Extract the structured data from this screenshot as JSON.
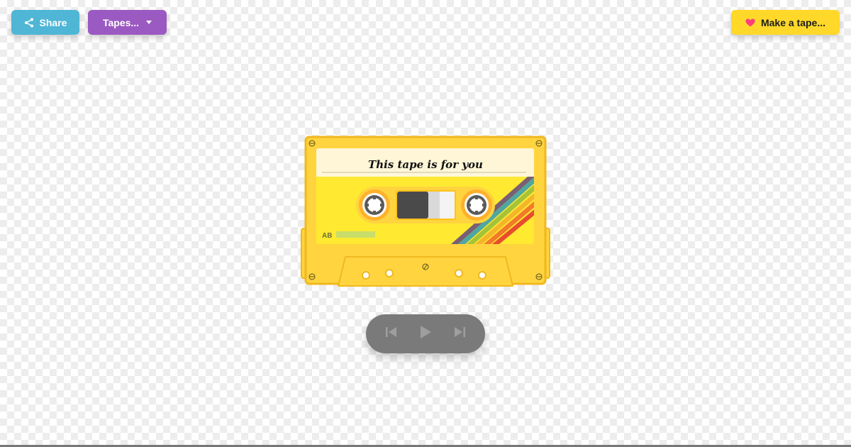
{
  "toolbar": {
    "share_label": "Share",
    "tapes_label": "Tapes...",
    "make_label": "Make a tape..."
  },
  "icons": {
    "share": "share-icon",
    "caret": "caret-down-icon",
    "heart": "heart-icon",
    "previous": "skip-previous-icon",
    "play": "play-icon",
    "next": "skip-next-icon"
  },
  "cassette": {
    "title": "This tape is for you",
    "side": "AB",
    "body_color": "#ffd43f",
    "label_color": "#fff6d8",
    "stripe_colors": [
      "#7a5f74",
      "#4fa7a0",
      "#a6c338",
      "#f5b52b",
      "#f27a2a",
      "#e84c2e"
    ]
  },
  "colors": {
    "share": "#4fb6d6",
    "tapes": "#9b59c2",
    "make": "#ffd829",
    "heart": "#ff3d7f",
    "player": "#7a7a7a"
  }
}
